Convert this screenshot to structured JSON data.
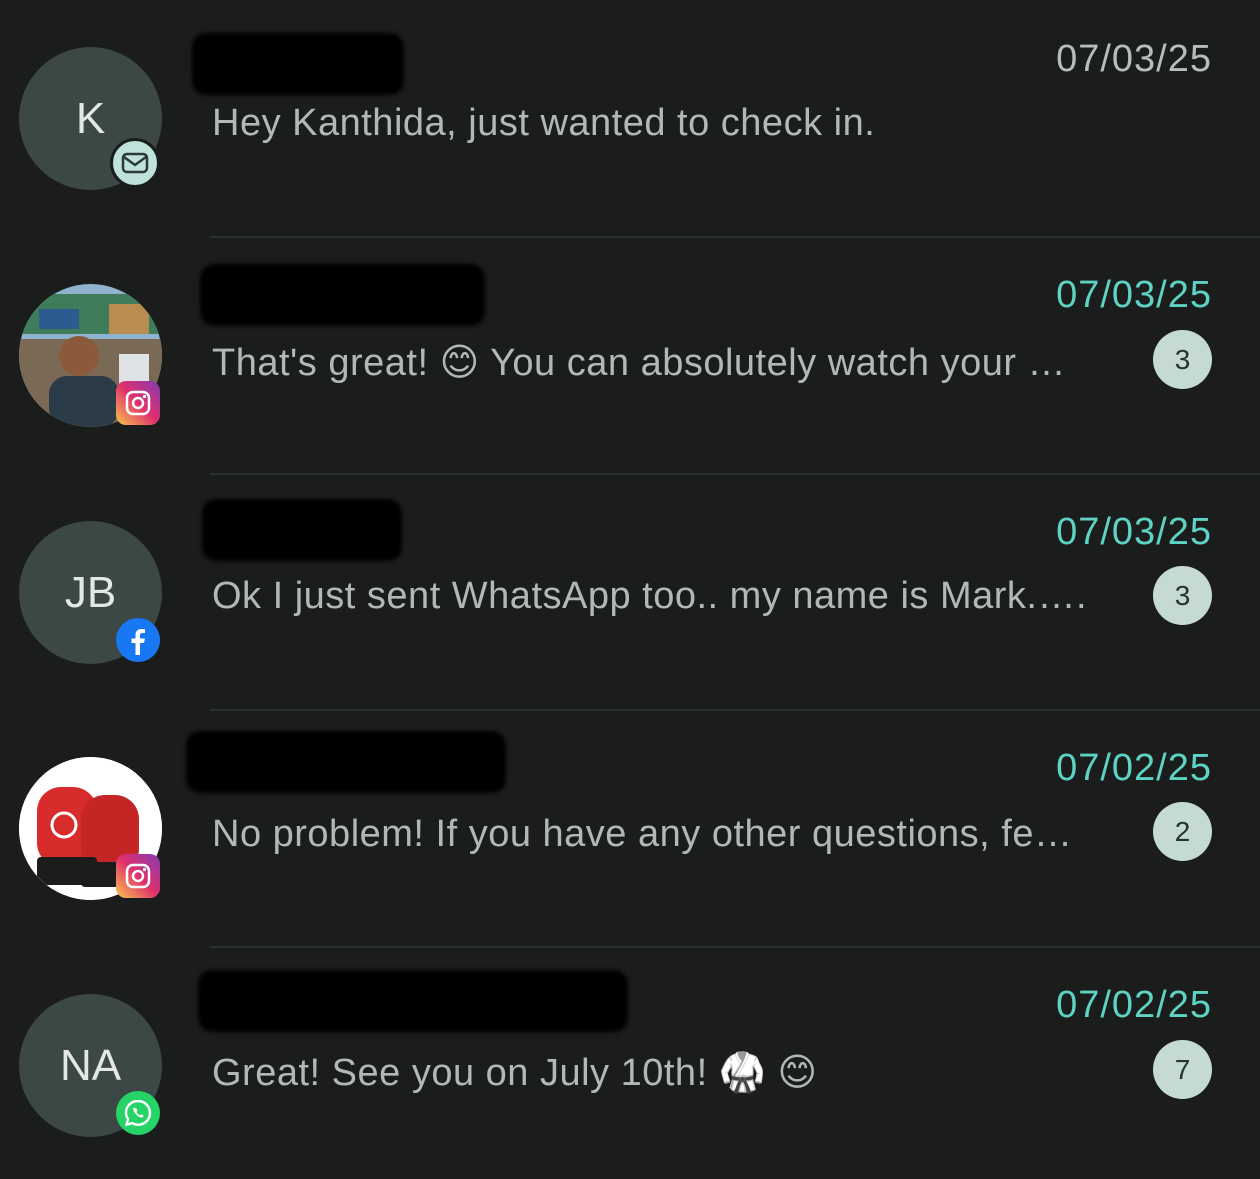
{
  "conversations": [
    {
      "avatar_initials": "K",
      "channel": "email-icon",
      "date": "07/03/25",
      "preview": "Hey Kanthida, just wanted to check in.",
      "unread": false,
      "count": ""
    },
    {
      "avatar_initials": "",
      "channel": "instagram-icon",
      "date": "07/03/25",
      "preview": "That's great! 😊  You can absolutely watch your …",
      "unread": true,
      "count": "3"
    },
    {
      "avatar_initials": "JB",
      "channel": "facebook-icon",
      "date": "07/03/25",
      "preview": "Ok I just sent WhatsApp too.. my name is Mark.….",
      "unread": true,
      "count": "3"
    },
    {
      "avatar_initials": "",
      "channel": "instagram-icon",
      "date": "07/02/25",
      "preview": "No problem! If you have any other questions, fe…",
      "unread": true,
      "count": "2"
    },
    {
      "avatar_initials": "NA",
      "channel": "whatsapp-icon",
      "date": "07/02/25",
      "preview": "Great! See you on July 10th! 🥋 😊",
      "unread": true,
      "count": "7"
    }
  ],
  "colors": {
    "background": "#1b1d1d",
    "accent_date": "#5fd3c3",
    "count_badge": "#c5d9d5"
  }
}
